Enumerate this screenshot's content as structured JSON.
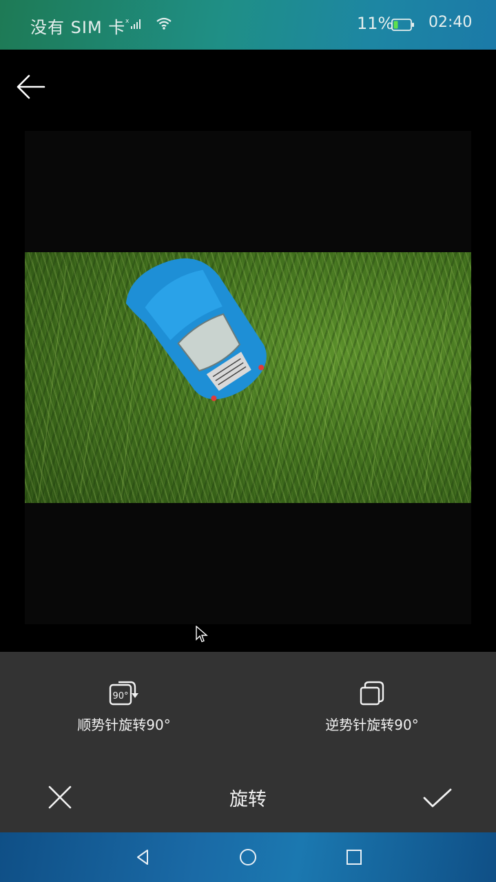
{
  "status_bar": {
    "carrier": "没有 SIM 卡",
    "battery_percent": "11%",
    "time": "02:40",
    "icons": [
      "signal-icon",
      "wifi-icon",
      "battery-icon"
    ]
  },
  "header": {
    "back_icon": "arrow-left-icon"
  },
  "image": {
    "description_icon": "photo"
  },
  "rotate_options": {
    "clockwise_label": "顺势针旋转90°",
    "clockwise_badge": "90°",
    "counterclockwise_label": "逆势针旋转90°"
  },
  "action_bar": {
    "title": "旋转",
    "cancel_icon": "close-icon",
    "confirm_icon": "check-icon"
  },
  "nav_bar": {
    "icons": [
      "back-triangle-icon",
      "home-circle-icon",
      "recent-square-icon"
    ]
  },
  "colors": {
    "panel": "#333333",
    "canvas": "#080808",
    "car": "#1e8fd6"
  }
}
